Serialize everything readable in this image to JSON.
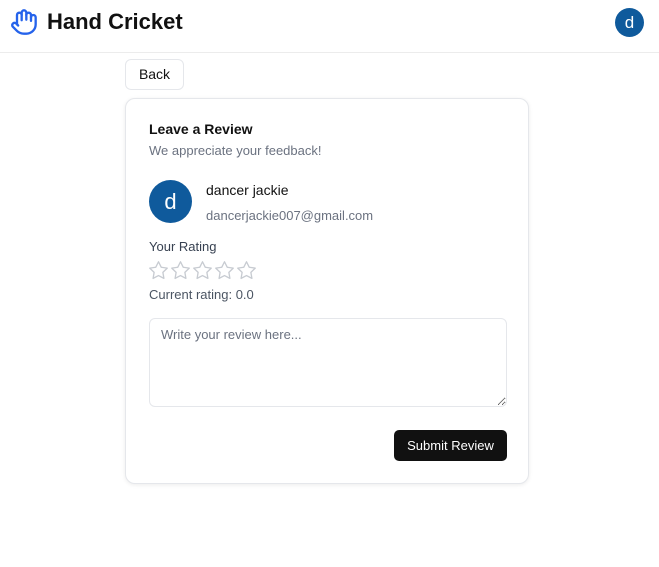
{
  "header": {
    "app_title": "Hand Cricket",
    "logo_icon": "hand-icon",
    "logo_color": "#2563eb",
    "user_initial": "d",
    "avatar_color": "#0f5a9c"
  },
  "nav": {
    "back_label": "Back"
  },
  "review_card": {
    "title": "Leave a Review",
    "subtitle": "We appreciate your feedback!",
    "user": {
      "initial": "d",
      "name": "dancer jackie",
      "email": "dancerjackie007@gmail.com"
    },
    "rating_label": "Your Rating",
    "star_icon": "star-outline-icon",
    "star_count": 5,
    "current_rating_prefix": "Current rating: ",
    "current_rating_value": "0.0",
    "review_placeholder": "Write your review here...",
    "review_value": "",
    "submit_label": "Submit Review"
  }
}
